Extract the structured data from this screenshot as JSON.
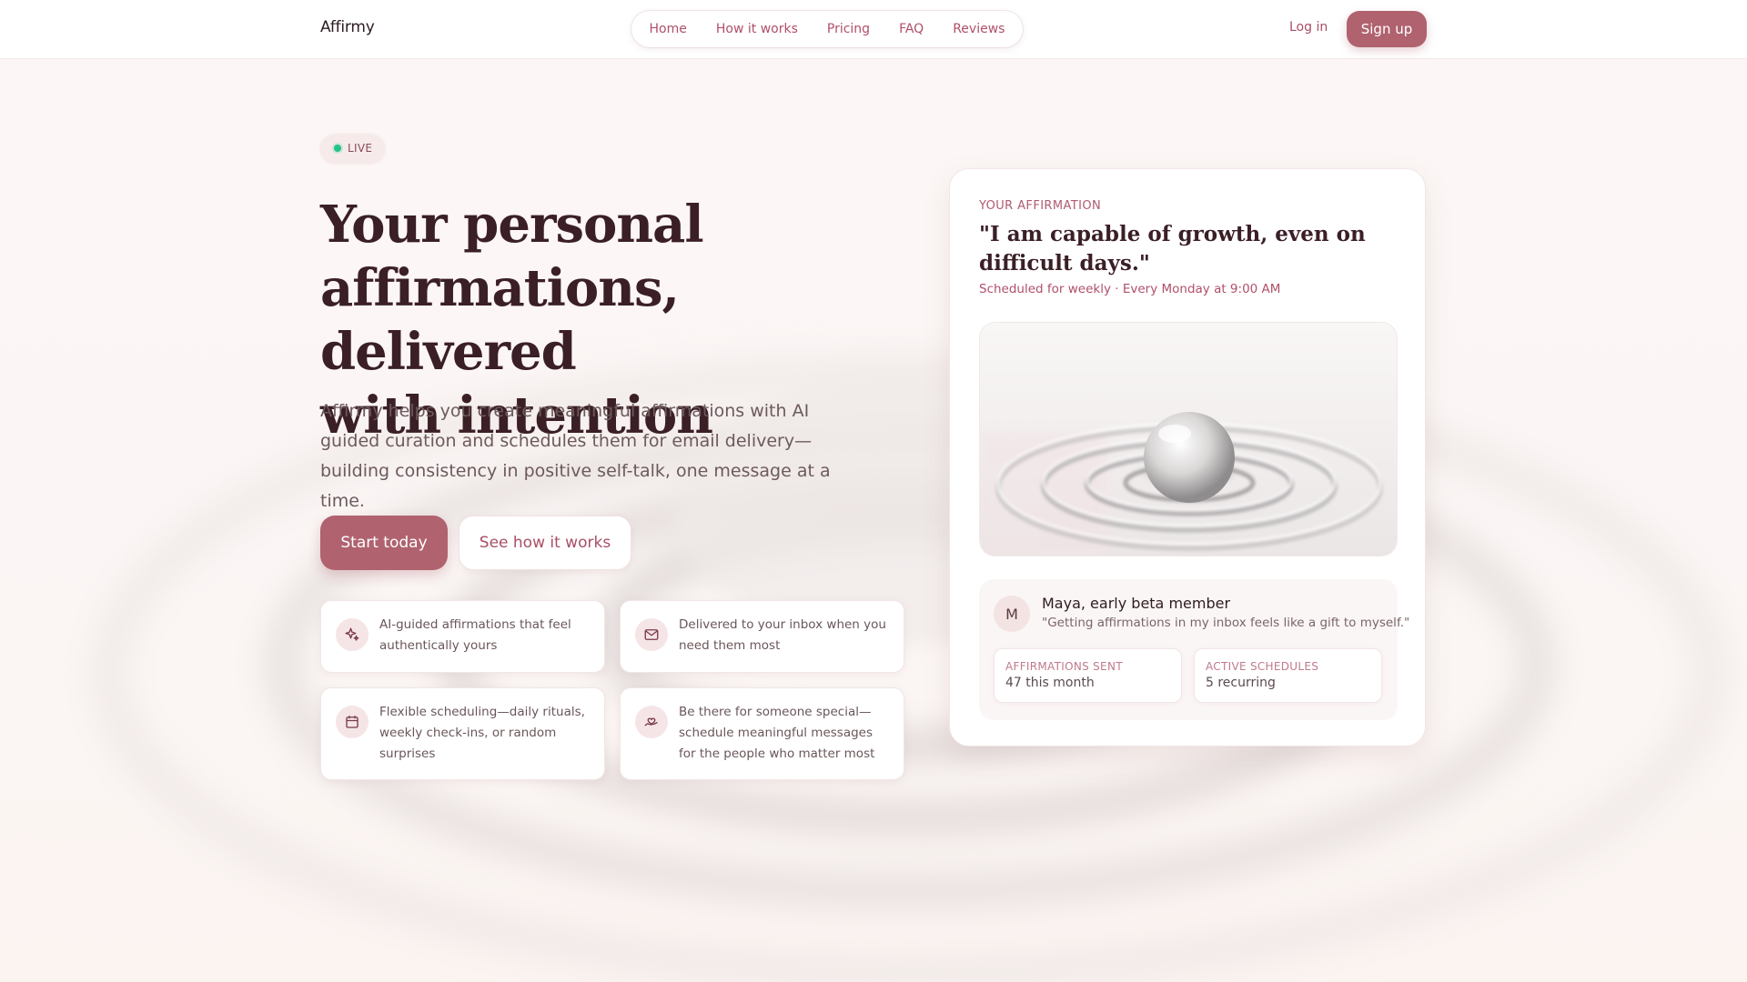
{
  "header": {
    "brand": "Affirmy",
    "nav": [
      "Home",
      "How it works",
      "Pricing",
      "FAQ",
      "Reviews"
    ],
    "login_label": "Log in",
    "signup_label": "Sign up"
  },
  "hero": {
    "badge": "LIVE",
    "title_lines": [
      "Your personal",
      "affirmations, delivered",
      "with intention"
    ],
    "subtitle": "Affirmy helps you create meaningful affirmations with AI guided curation and schedules them for email delivery—building consistency in positive self-talk, one message at a time.",
    "primary_cta": "Start today",
    "secondary_cta": "See how it works",
    "features": [
      {
        "icon": "sparkles-icon",
        "text": "AI-guided affirmations that feel authentically yours"
      },
      {
        "icon": "mail-icon",
        "text": "Delivered to your inbox when you need them most"
      },
      {
        "icon": "calendar-icon",
        "text": "Flexible scheduling—daily rituals, weekly check-ins, or random surprises"
      },
      {
        "icon": "heart-hand-icon",
        "text": "Be there for someone special—schedule meaningful messages for the people who matter most"
      }
    ]
  },
  "card": {
    "eyebrow": "YOUR AFFIRMATION",
    "quote": "\"I am capable of growth, even on difficult days.\"",
    "schedule": "Scheduled for weekly · Every Monday at 9:00 AM",
    "testimonial": {
      "avatar": "M",
      "name": "Maya, early beta member",
      "quote": "\"Getting affirmations in my inbox feels like a gift to myself.\""
    },
    "stats": [
      {
        "label": "AFFIRMATIONS SENT",
        "value": "47 this month"
      },
      {
        "label": "ACTIVE SCHEDULES",
        "value": "5 recurring"
      }
    ]
  },
  "colors": {
    "accent": "#b0626f",
    "accent_text": "#b0506a",
    "heading": "#3b1f26",
    "live": "#22c389"
  }
}
